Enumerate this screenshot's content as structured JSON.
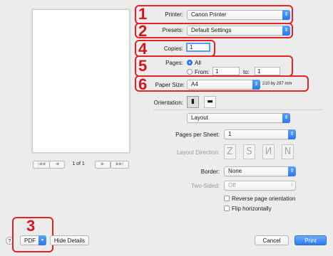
{
  "preview": {
    "page_indicator": "1 of 1",
    "first_glyph": "|◀◀",
    "prev_glyph": "◀",
    "next_glyph": "▶",
    "last_glyph": "▶▶|"
  },
  "printer": {
    "label": "Printer:",
    "value": "Canon Printer"
  },
  "presets": {
    "label": "Presets:",
    "value": "Default Settings"
  },
  "copies": {
    "label": "Copies:",
    "value": "1"
  },
  "pages": {
    "label": "Pages:",
    "all_label": "All",
    "from_label": "From:",
    "from_value": "1",
    "to_label": "to:",
    "to_value": "1",
    "selected": "All"
  },
  "paper_size": {
    "label": "Paper Size:",
    "value": "A4",
    "dimensions": "210 by 297 mm"
  },
  "orientation": {
    "label": "Orientation:",
    "selected": "portrait",
    "portrait_glyph": "▮",
    "landscape_glyph": "▬"
  },
  "section": {
    "value": "Layout"
  },
  "layout": {
    "pages_per_sheet_label": "Pages per Sheet:",
    "pages_per_sheet_value": "1",
    "layout_direction_label": "Layout Direction:",
    "direction_glyphs": [
      "Z",
      "S",
      "И",
      "N"
    ],
    "border_label": "Border:",
    "border_value": "None",
    "two_sided_label": "Two-Sided:",
    "two_sided_value": "Off",
    "reverse_label": "Reverse page orientation",
    "flip_label": "Flip horizontally"
  },
  "bottom": {
    "help": "?",
    "pdf_label": "PDF",
    "hide_details": "Hide Details",
    "cancel": "Cancel",
    "print": "Print"
  },
  "annotations": {
    "n1": "1",
    "n2": "2",
    "n3": "3",
    "n4": "4",
    "n5": "5",
    "n6": "6",
    "color": "#e0242a"
  },
  "colors": {
    "accent": "#2b7cf0",
    "annotation_red": "#e0242a",
    "background": "#ececec"
  },
  "icons": {
    "popup_arrow": "chevron-updown-icon",
    "pdf_arrow": "chevron-down-icon"
  }
}
